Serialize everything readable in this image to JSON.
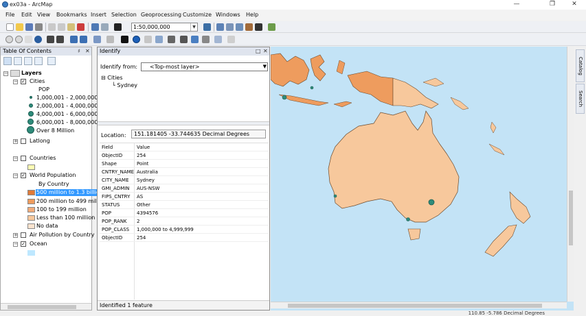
{
  "window": {
    "title": "ex03a - ArcMap"
  },
  "menu": [
    "File",
    "Edit",
    "View",
    "Bookmarks",
    "Insert",
    "Selection",
    "Geoprocessing",
    "Customize",
    "Windows",
    "Help"
  ],
  "toolbar": {
    "scale_value": "1:50,000,000"
  },
  "toc": {
    "title": "Table Of Contents",
    "layers_label": "Layers",
    "cities": {
      "label": "Cities",
      "field": "POP",
      "classes": [
        "1,000,001 - 2,000,000",
        "2,000,001 - 4,000,000",
        "4,000,001 - 6,000,000",
        "6,000,001 - 8,000,000",
        "Over 8 Million"
      ]
    },
    "latlong_label": "Latlong",
    "countries_label": "Countries",
    "world_population": {
      "label": "World Population",
      "sublabel": "By Country",
      "classes": [
        {
          "label": "500 million to 1.3 billio",
          "color": "#e07b39"
        },
        {
          "label": "200 million to 499 milli",
          "color": "#ee9c5e"
        },
        {
          "label": "100 to 199 million",
          "color": "#f2ac7a"
        },
        {
          "label": "Less than 100 million",
          "color": "#f7c89c"
        },
        {
          "label": "No data",
          "color": "#fbe4cf"
        }
      ]
    },
    "air_pollution_label": "Air Pollution by Country",
    "ocean_label": "Ocean",
    "colors": {
      "countries_fill": "#ffffb4",
      "ocean_fill": "#bee8ff",
      "selection_bg": "#3399ff"
    }
  },
  "identify": {
    "title": "Identify",
    "from_label": "Identify from:",
    "from_value": "<Top-most layer>",
    "tree_layer": "Cities",
    "tree_feature": "Sydney",
    "location_label": "Location:",
    "location_value": "151.181405  -33.744635 Decimal Degrees",
    "col_field": "Field",
    "col_value": "Value",
    "rows": [
      {
        "field": "ObjectID",
        "value": "254"
      },
      {
        "field": "Shape",
        "value": "Point"
      },
      {
        "field": "CNTRY_NAME",
        "value": "Australia"
      },
      {
        "field": "CITY_NAME",
        "value": "Sydney"
      },
      {
        "field": "GMI_ADMIN",
        "value": "AUS-NSW"
      },
      {
        "field": "FIPS_CNTRY",
        "value": "AS"
      },
      {
        "field": "STATUS",
        "value": "Other"
      },
      {
        "field": "POP",
        "value": "4394576"
      },
      {
        "field": "POP_RANK",
        "value": "2"
      },
      {
        "field": "POP_CLASS",
        "value": "1,000,000 to 4,999,999"
      },
      {
        "field": "ObjectID",
        "value": "254"
      }
    ],
    "status": "Identified 1 feature"
  },
  "map": {
    "ocean_color": "#c3e3f6",
    "land_colors": {
      "australia": "#f7c89c",
      "indonesia": "#ee9c5e",
      "png": "#f7c89c",
      "nz": "#f7c89c"
    }
  },
  "side_tabs": [
    "Catalog",
    "Search"
  ],
  "statusbar": {
    "coords": "110.85  -5.786 Decimal Degrees"
  }
}
